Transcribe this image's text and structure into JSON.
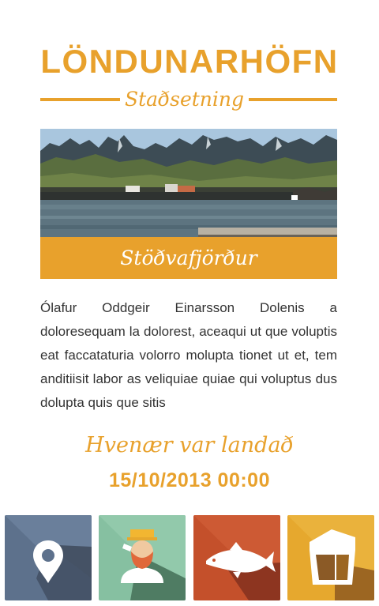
{
  "header": {
    "title": "LÖNDUNARHÖFN",
    "subtitle": "Staðsetning"
  },
  "location": {
    "name": "Stöðvafjörður"
  },
  "description": "Ólafur Oddgeir Einarsson Dolenis a doloresequam la dolorest, aceaqui ut que voluptis eat faccataturia volorro molupta tionet ut et, tem anditiisit labor as veliquiae quiae qui voluptus dus dolupta quis que sitis",
  "landing": {
    "label": "Hvenær var landað",
    "datetime": "15/10/2013 00:00"
  },
  "nav": [
    {
      "icon": "map-pin-icon",
      "color": "#5d718c"
    },
    {
      "icon": "fisherman-icon",
      "color": "#86c0a1"
    },
    {
      "icon": "fish-icon",
      "color": "#c4502b"
    },
    {
      "icon": "boat-icon",
      "color": "#e6a82e"
    }
  ],
  "colors": {
    "accent": "#e8a12c",
    "text": "#333333"
  }
}
